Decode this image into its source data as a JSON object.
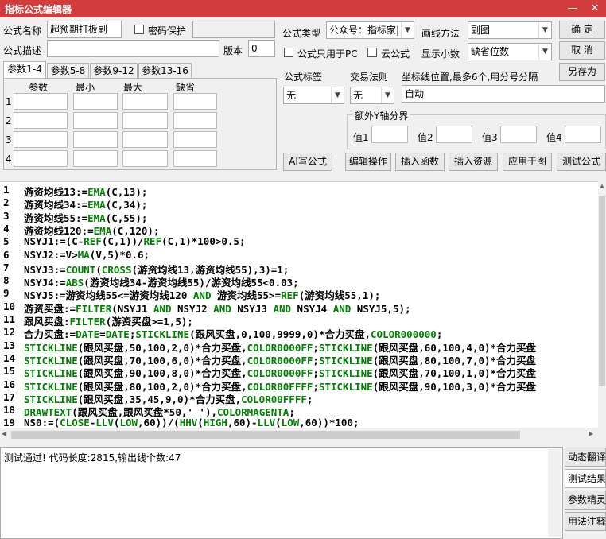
{
  "window": {
    "title": "指标公式编辑器",
    "minimize": "—",
    "close": "✕"
  },
  "form": {
    "name_label": "公式名称",
    "name_value": "超预期打板副",
    "password_label": "密码保护",
    "desc_label": "公式描述",
    "desc_value": "",
    "version_label": "版本",
    "version_value": "0",
    "type_label": "公式类型",
    "type_value": "公众号：指标家|",
    "draw_label": "画线方法",
    "draw_value": "副图",
    "pc_only_label": "公式只用于PC",
    "cloud_label": "云公式",
    "decimals_label": "显示小数",
    "decimals_value": "缺省位数"
  },
  "buttons": {
    "ok": "确  定",
    "cancel": "取  消",
    "save_as": "另存为"
  },
  "tabs": [
    "参数1-4",
    "参数5-8",
    "参数9-12",
    "参数13-16"
  ],
  "params": {
    "headers": [
      "参数",
      "最小",
      "最大",
      "缺省"
    ],
    "rows": [
      "1",
      "2",
      "3",
      "4"
    ]
  },
  "tags": {
    "formula_tag_label": "公式标签",
    "formula_tag_value": "无",
    "trade_rule_label": "交易法则",
    "trade_rule_value": "无",
    "coord_label": "坐标线位置,最多6个,用分号分隔",
    "coord_value": "自动"
  },
  "yaxis": {
    "label": "额外Y轴分界",
    "v1": "值1",
    "v2": "值2",
    "v3": "值3",
    "v4": "值4"
  },
  "actions": [
    "AI写公式",
    "编辑操作",
    "插入函数",
    "插入资源",
    "应用于图",
    "测试公式"
  ],
  "code_lines": [
    {
      "n": "1",
      "segs": [
        [
          "游资均线13:=",
          "k"
        ],
        [
          "EMA",
          "f"
        ],
        [
          "(C,13);",
          "k"
        ]
      ]
    },
    {
      "n": "2",
      "segs": [
        [
          "游资均线34:=",
          "k"
        ],
        [
          "EMA",
          "f"
        ],
        [
          "(C,34);",
          "k"
        ]
      ]
    },
    {
      "n": "3",
      "segs": [
        [
          "游资均线55:=",
          "k"
        ],
        [
          "EMA",
          "f"
        ],
        [
          "(C,55);",
          "k"
        ]
      ]
    },
    {
      "n": "4",
      "segs": [
        [
          "游资均线120:=",
          "k"
        ],
        [
          "EMA",
          "f"
        ],
        [
          "(C,120);",
          "k"
        ]
      ]
    },
    {
      "n": "5",
      "segs": [
        [
          "NSYJ1:=(C-",
          "k"
        ],
        [
          "REF",
          "f"
        ],
        [
          "(C,1))/",
          "k"
        ],
        [
          "REF",
          "f"
        ],
        [
          "(C,1)*100>0.5;",
          "k"
        ]
      ]
    },
    {
      "n": "6",
      "segs": [
        [
          "NSYJ2:=V>",
          "k"
        ],
        [
          "MA",
          "f"
        ],
        [
          "(V,5)*0.6;",
          "k"
        ]
      ]
    },
    {
      "n": "7",
      "segs": [
        [
          "NSYJ3:=",
          "k"
        ],
        [
          "COUNT",
          "f"
        ],
        [
          "(",
          "k"
        ],
        [
          "CROSS",
          "f"
        ],
        [
          "(游资均线13,游资均线55),3)=1;",
          "k"
        ]
      ]
    },
    {
      "n": "8",
      "segs": [
        [
          "NSYJ4:=",
          "k"
        ],
        [
          "ABS",
          "f"
        ],
        [
          "(游资均线34-游资均线55)/游资均线55<0.03;",
          "k"
        ]
      ]
    },
    {
      "n": "9",
      "segs": [
        [
          "NSYJ5:=游资均线55<=游资均线120 ",
          "k"
        ],
        [
          "AND",
          "f"
        ],
        [
          " 游资均线55>=",
          "k"
        ],
        [
          "REF",
          "f"
        ],
        [
          "(游资均线55,1);",
          "k"
        ]
      ]
    },
    {
      "n": "10",
      "segs": [
        [
          "游资买盘:=",
          "k"
        ],
        [
          "FILTER",
          "f"
        ],
        [
          "(NSYJ1 ",
          "k"
        ],
        [
          "AND",
          "f"
        ],
        [
          " NSYJ2 ",
          "k"
        ],
        [
          "AND",
          "f"
        ],
        [
          " NSYJ3 ",
          "k"
        ],
        [
          "AND",
          "f"
        ],
        [
          " NSYJ4 ",
          "k"
        ],
        [
          "AND",
          "f"
        ],
        [
          " NSYJ5,5);",
          "k"
        ]
      ]
    },
    {
      "n": "11",
      "segs": [
        [
          "跟风买盘:",
          "k"
        ],
        [
          "FILTER",
          "f"
        ],
        [
          "(游资买盘>=1,5);",
          "k"
        ]
      ]
    },
    {
      "n": "12",
      "segs": [
        [
          "合力买盘:=",
          "k"
        ],
        [
          "DATE",
          "f"
        ],
        [
          "=",
          "k"
        ],
        [
          "DATE",
          "f"
        ],
        [
          ";",
          "k"
        ],
        [
          "STICKLINE",
          "f"
        ],
        [
          "(跟风买盘,0,100,9999,0)*合力买盘,",
          "k"
        ],
        [
          "COLOR000000",
          "f"
        ],
        [
          ";",
          "k"
        ]
      ]
    },
    {
      "n": "13",
      "segs": [
        [
          "STICKLINE",
          "f"
        ],
        [
          "(跟风买盘,50,100,2,0)*合力买盘,",
          "k"
        ],
        [
          "COLOR0000FF",
          "f"
        ],
        [
          ";",
          "k"
        ],
        [
          "STICKLINE",
          "f"
        ],
        [
          "(跟风买盘,60,100,4,0)*合力买盘",
          "k"
        ]
      ]
    },
    {
      "n": "14",
      "segs": [
        [
          "STICKLINE",
          "f"
        ],
        [
          "(跟风买盘,70,100,6,0)*合力买盘,",
          "k"
        ],
        [
          "COLOR0000FF",
          "f"
        ],
        [
          ";",
          "k"
        ],
        [
          "STICKLINE",
          "f"
        ],
        [
          "(跟风买盘,80,100,7,0)*合力买盘",
          "k"
        ]
      ]
    },
    {
      "n": "15",
      "segs": [
        [
          "STICKLINE",
          "f"
        ],
        [
          "(跟风买盘,90,100,8,0)*合力买盘,",
          "k"
        ],
        [
          "COLOR0000FF",
          "f"
        ],
        [
          ";",
          "k"
        ],
        [
          "STICKLINE",
          "f"
        ],
        [
          "(跟风买盘,70,100,1,0)*合力买盘",
          "k"
        ]
      ]
    },
    {
      "n": "16",
      "segs": [
        [
          "STICKLINE",
          "f"
        ],
        [
          "(跟风买盘,80,100,2,0)*合力买盘,",
          "k"
        ],
        [
          "COLOR00FFFF",
          "f"
        ],
        [
          ";",
          "k"
        ],
        [
          "STICKLINE",
          "f"
        ],
        [
          "(跟风买盘,90,100,3,0)*合力买盘",
          "k"
        ]
      ]
    },
    {
      "n": "17",
      "segs": [
        [
          "STICKLINE",
          "f"
        ],
        [
          "(跟风买盘,35,45,9,0)*合力买盘,",
          "k"
        ],
        [
          "COLOR00FFFF",
          "f"
        ],
        [
          ";",
          "k"
        ]
      ]
    },
    {
      "n": "18",
      "segs": [
        [
          "DRAWTEXT",
          "f"
        ],
        [
          "(跟风买盘,跟风买盘*50,' '),",
          "k"
        ],
        [
          "COLORMAGENTA",
          "f"
        ],
        [
          ";",
          "k"
        ]
      ]
    },
    {
      "n": "19",
      "segs": [
        [
          "NS0:=(",
          "k"
        ],
        [
          "CLOSE",
          "f"
        ],
        [
          "-",
          "k"
        ],
        [
          "LLV",
          "f"
        ],
        [
          "(",
          "k"
        ],
        [
          "LOW",
          "f"
        ],
        [
          ",60))/(",
          "k"
        ],
        [
          "HHV",
          "f"
        ],
        [
          "(",
          "k"
        ],
        [
          "HIGH",
          "f"
        ],
        [
          ",60)-",
          "k"
        ],
        [
          "LLV",
          "f"
        ],
        [
          "(",
          "k"
        ],
        [
          "LOW",
          "f"
        ],
        [
          ",60))*100;",
          "k"
        ]
      ]
    }
  ],
  "colors": {
    "keyword": "#000000",
    "function": "#008000",
    "titlebar": "#d23c3c"
  },
  "output_text": "测试通过! 代码长度:2815,输出线个数:47",
  "side_buttons": [
    "动态翻译",
    "测试结果",
    "参数精灵",
    "用法注释"
  ]
}
